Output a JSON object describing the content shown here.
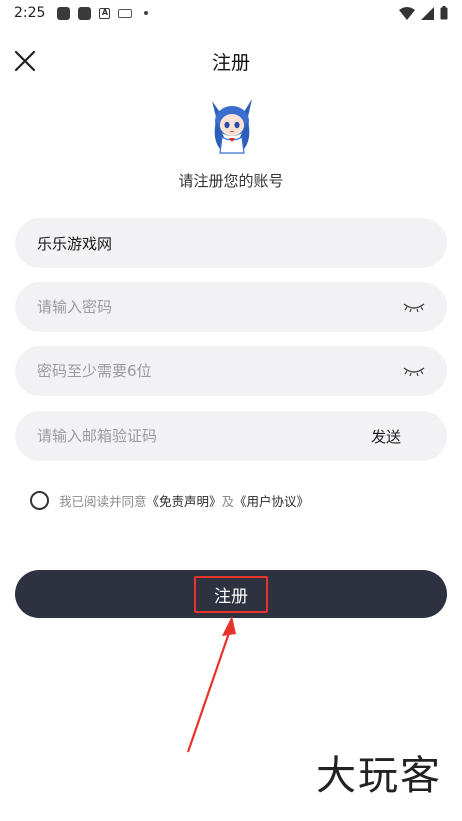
{
  "status": {
    "time": "2:25"
  },
  "header": {
    "title": "注册"
  },
  "subtitle": "请注册您的账号",
  "form": {
    "username_value": "乐乐游戏网",
    "password_placeholder": "请输入密码",
    "confirm_placeholder": "密码至少需要6位",
    "code_placeholder": "请输入邮箱验证码",
    "send_label": "发送"
  },
  "agreement": {
    "prefix": "我已阅读并同意",
    "disclaimer": "《免责声明》",
    "and": "及",
    "user_agreement": "《用户协议》"
  },
  "submit_label": "注册",
  "watermark": "大玩客",
  "colors": {
    "button_bg": "#2e3240",
    "field_bg": "#f2f2f4",
    "highlight": "#e8332c"
  }
}
